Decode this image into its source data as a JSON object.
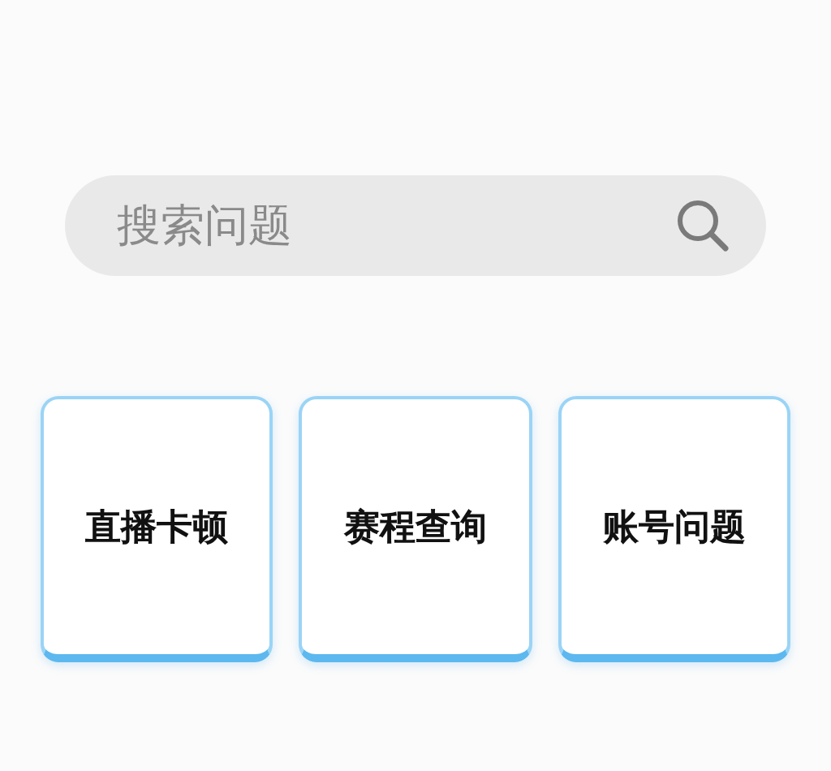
{
  "search": {
    "placeholder": "搜索问题"
  },
  "categories": [
    {
      "label": "直播卡顿"
    },
    {
      "label": "赛程查询"
    },
    {
      "label": "账号问题"
    }
  ]
}
